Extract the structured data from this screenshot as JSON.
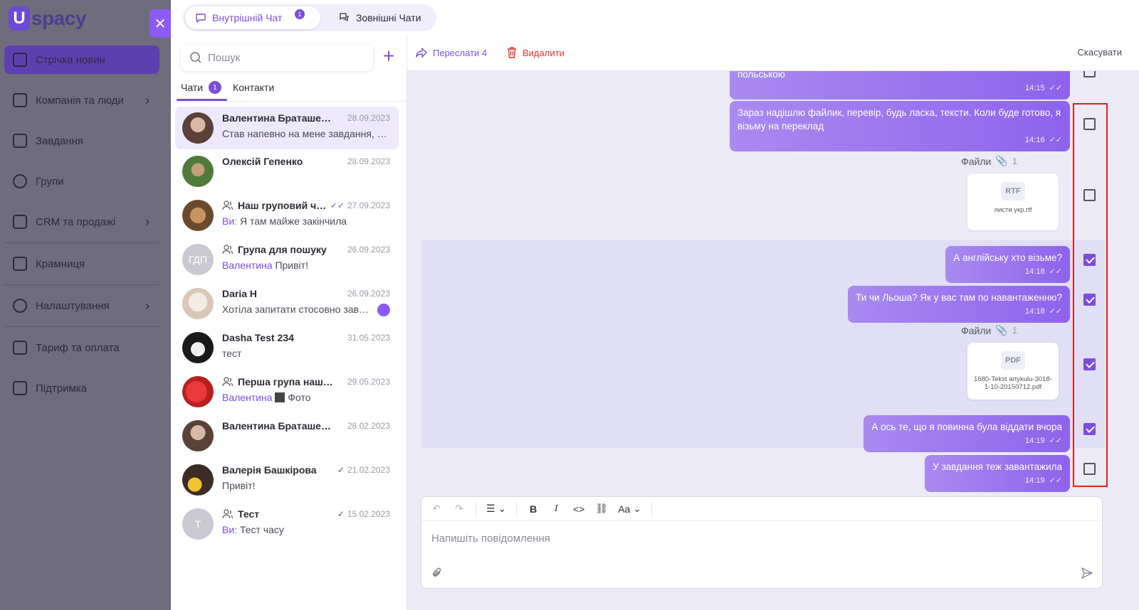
{
  "app": {
    "logo_text": "spacy",
    "logo_mark": "U"
  },
  "sidebar": {
    "items": [
      {
        "label": "Стрічка новин",
        "icon": "home-icon"
      },
      {
        "label": "Компанія та люди",
        "icon": "building-icon",
        "chevron": "›"
      },
      {
        "label": "Завдання",
        "icon": "calendar-icon"
      },
      {
        "label": "Групи",
        "icon": "users-icon"
      },
      {
        "label": "CRM та продажі",
        "icon": "database-icon",
        "chevron": "›"
      },
      {
        "label": "Крамниця",
        "icon": "store-icon"
      },
      {
        "label": "Налаштування",
        "icon": "gear-icon",
        "chevron": "›"
      },
      {
        "label": "Тариф та оплата",
        "icon": "wallet-icon"
      },
      {
        "label": "Підтримка",
        "icon": "support-icon"
      }
    ]
  },
  "topbar": {
    "tab_internal": "Внутрішній Чат",
    "tab_internal_badge": "1",
    "tab_external": "Зовнішні Чати"
  },
  "chatlist": {
    "search_placeholder": "Пошук",
    "tab_chats": "Чати",
    "tab_chats_count": "1",
    "tab_contacts": "Контакти",
    "chats": [
      {
        "name": "Валентина Браташевс...",
        "date": "28.09.2023",
        "preview": "Став напевно на мене завдання, я ...",
        "sender": "",
        "group": false
      },
      {
        "name": "Олексій Гепенко",
        "date": "28.09.2023",
        "preview": "",
        "sender": "",
        "group": false
      },
      {
        "name": "Наш груповий ча...",
        "date": "27.09.2023",
        "preview": "Я там майже закінчила",
        "sender": "Ви:",
        "group": true
      },
      {
        "name": "Група для пошуку",
        "date": "26.09.2023",
        "preview": "Привіт!",
        "sender": "Валентина",
        "group": true,
        "initials": "ГДП"
      },
      {
        "name": "Daria H",
        "date": "26.09.2023",
        "preview": "Хотіла запитати стосовно завд...",
        "sender": "",
        "group": false
      },
      {
        "name": "Dasha Test 234",
        "date": "31.05.2023",
        "preview": "тест",
        "sender": "",
        "group": false
      },
      {
        "name": "Перша група нашог...",
        "date": "29.05.2023",
        "preview": "Фото",
        "sender": "Валентина",
        "group": true
      },
      {
        "name": "Валентина Браташевс...",
        "date": "28.02.2023",
        "preview": "",
        "sender": "",
        "group": false
      },
      {
        "name": "Валерія Башкірова",
        "date": "21.02.2023",
        "preview": "Привіт!",
        "sender": "",
        "group": false
      },
      {
        "name": "Тест",
        "date": "15.02.2023",
        "preview": "Тест часу",
        "sender": "Ви:",
        "group": true,
        "initials": "Т"
      }
    ]
  },
  "actions": {
    "forward": "Переслати 4",
    "delete": "Видалити",
    "cancel": "Скасувати"
  },
  "messages": {
    "m0_text": "польською",
    "m0_time": "14:15",
    "m1_text": "Зараз надішлю файлик, перевір, будь ласка, тексти. Коли буде готово, я візьму на переклад",
    "m1_time": "14:16",
    "files1_label": "Файли",
    "files1_count": "1",
    "file1_type": "RTF",
    "file1_name": "листи укр.rtf",
    "m2_text": "А англійську хто візьме?",
    "m2_time": "14:18",
    "m3_text": "Ти чи Льоша? Як у вас там по навантаженню?",
    "m3_time": "14:18",
    "files2_label": "Файли",
    "files2_count": "1",
    "file2_type": "PDF",
    "file2_name": "1680-Tekst artykulu-3018-1-10-20150712.pdf",
    "m4_text": "А ось те, що я повинна була віддати вчора",
    "m4_time": "14:19",
    "m5_text": "У завдання теж завантажила",
    "m5_time": "14:19"
  },
  "composer": {
    "placeholder": "Напишіть повідомлення",
    "font_label": "Aa",
    "bold": "B",
    "italic": "I"
  },
  "colors": {
    "accent": "#7c4ddb",
    "danger": "#e0312f",
    "highlight": "#e02020"
  }
}
